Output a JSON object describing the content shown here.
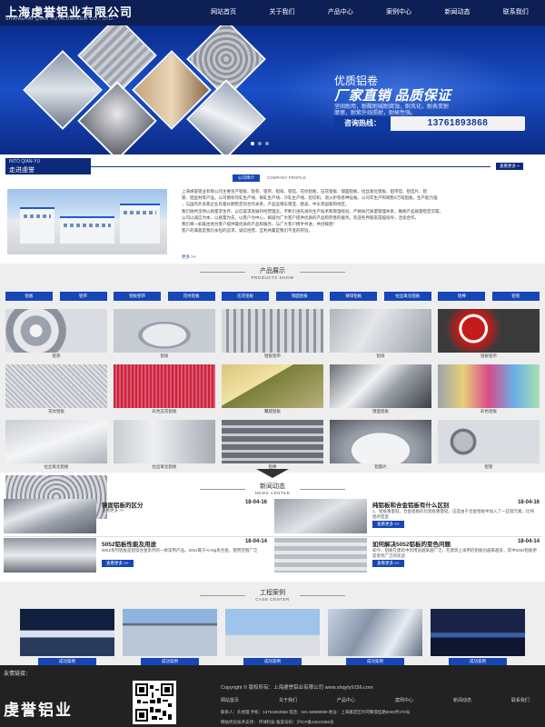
{
  "header": {
    "logo_cn": "上海虔誉铝业有限公司",
    "logo_en": "SHANGHAI QIAN YU ALUMINUM CO., LTD.",
    "nav": [
      "网站首页",
      "关于我们",
      "产品中心",
      "案例中心",
      "新闻动态",
      "联系我们"
    ]
  },
  "banner": {
    "title": "优质铝卷",
    "headline": "厂家直销 品质保证",
    "desc": [
      "坚固耐用，耐酸耐碱耐腐蚀，耐风化，耐表变耐",
      "摩擦，耐紫外线照射，耐候性强。"
    ],
    "hotline_label": "咨询热线：",
    "hotline_number": "13761893868"
  },
  "about": {
    "tag_en": "INTO QIAN-YU",
    "tag_cn": "走进虔誉",
    "more": "查看更多 >",
    "tabs": [
      "公司简介",
      "COMPANY PROFILE"
    ],
    "text": [
      "上海虔誉铝业有限公司主要生产铝板、铝卷、铝带、铝排、铝箔、花纹铝板、压花铝板、镜面铝板、拉丝氧化铝板、铝带箔、铝箔片、铝",
      "管、铝型材等产品。公司拥有热轧生产线、铸轧生产线、冷轧生产线、剪切机、退火炉等各种设备。公司年生产和销售5万吨铝板，生产能力强",
      "，与国内外多家企业有着长期稳定的合作关系，产品远销东南亚、欧美、中东等国家和地区。",
      "我们始终坚持以质量求生存、以信誉求发展的经营理念，不断引进先进的生产技术和管理经验，严格执行质量管理体系，确保产品质量稳定可靠。",
      "公司以诚信为本，以质量为先，以客户为中心，竭诚为广大客户提供优质的产品和完善的服务。欢迎各界朋友莅临指导，洽谈合作。",
      "我们将一如既往地为客户提供最优质的产品和服务，与广大客户携手共进，共创辉煌！",
      "客户的满意是我们永恒的追求，诚信经营、互利共赢是我们不变的宗旨。"
    ],
    "more_inline": "更多 >>"
  },
  "products": {
    "title_cn": "产品展示",
    "title_en": "PRODUCTS SHOW",
    "categories": [
      "铝板",
      "铝带",
      "铝板铝带",
      "花纹铝板",
      "压花铝板",
      "镜面铝板",
      "镀锌铝板",
      "拉丝氧化铝板",
      "铝棒",
      "铝卷"
    ],
    "items": [
      "铝卷",
      "铝板",
      "铝板铝带",
      "铝排",
      "铝板铝带",
      "花纹铝板",
      "彩色压花铝板",
      "覆膜铝板",
      "镜面铝板",
      "彩色铝板",
      "拉丝氧化铝板",
      "拉丝氧化铝板",
      "铝棒",
      "铝圆片",
      "铝管",
      "铝卷"
    ]
  },
  "news": {
    "title_cn": "新闻动态",
    "title_en": "NEWS CENTER",
    "items": [
      {
        "title": "镜面铝板的区分",
        "date": "18-04-16",
        "summary": "",
        "more": "查看更多 >>"
      },
      {
        "title": "纯铝板和合金铝板有什么区别",
        "date": "18-04-16",
        "summary": "1、铝板重量轻。合金铝板的比铝板重量轻，这是由于合金铝板中加入了一些镁元素，比纯铝的密度",
        "more": "查看更多 >>"
      },
      {
        "title": "5052铝板性能及用途",
        "date": "18-04-14",
        "summary": "5052系列铝板是铝镁合金系列的一款常用产品。5052属于Al-Mg系合金，使用范围广泛",
        "more": "查看更多 >>"
      },
      {
        "title": "如何解决5052铝板的变色问题",
        "date": "18-04-14",
        "summary": "如今，铝板在建筑中的用途越来越广泛，在建筑上采用的铝板也越来越多，其中5052铝板更是受到广泛的欢迎",
        "more": "查看更多 >>"
      }
    ]
  },
  "cases": {
    "title_cn": "工程案例",
    "title_en": "CASE CENTER",
    "items": [
      "成功案例",
      "成功案例",
      "成功案例",
      "成功案例",
      "成功案例"
    ]
  },
  "footer": {
    "friend_links": "友情链接：",
    "logo": "虔誉铝业",
    "copyright": "Copyright © 版权所有：上海虔誉铝业有限公司   www.shqyly9156.com",
    "nav": [
      "网站首页",
      "关于我们",
      "产品中心",
      "案例中心",
      "新闻动态",
      "联系我们"
    ],
    "contact": "联系人：孔经理  手机：13761893868  电话：021-59969059  地址：上海嘉定区外冈镇澄桂路5000弄270号",
    "tech": "网站优化技术支持：    环球科技       备案号码：沪ICP备16023386号"
  }
}
